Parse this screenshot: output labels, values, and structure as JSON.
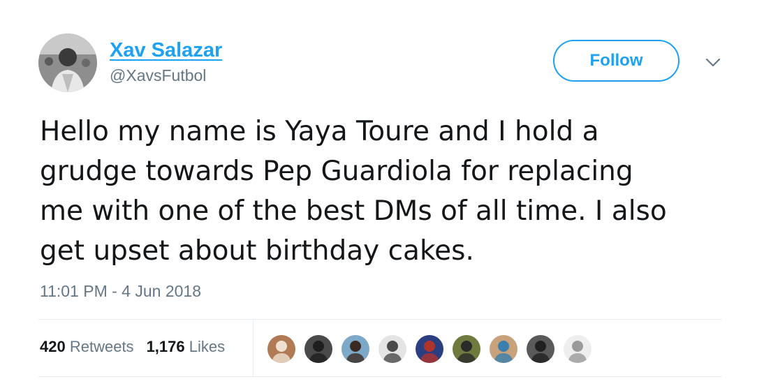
{
  "author": {
    "display_name": "Xav Salazar",
    "handle": "@XavsFutbol",
    "avatar_icon": "user-avatar-icon"
  },
  "actions": {
    "follow_label": "Follow",
    "more_icon": "chevron-down-icon"
  },
  "tweet": {
    "text": "Hello my name is Yaya Toure and I hold a\ngrudge towards Pep Guardiola for replacing\nme with one of the best DMs of all time. I also\nget upset about birthday cakes.",
    "timestamp": "11:01 PM - 4 Jun 2018"
  },
  "stats": {
    "retweets_count": "420",
    "retweets_label": "Retweets",
    "likes_count": "1,176",
    "likes_label": "Likes"
  },
  "likers": [
    {
      "icon": "liker-avatar-icon",
      "bg": "#b07a55",
      "fg": "#efe0d0"
    },
    {
      "icon": "liker-avatar-icon",
      "bg": "#4a4a4a",
      "fg": "#1e1e1e"
    },
    {
      "icon": "liker-avatar-icon",
      "bg": "#7da9c8",
      "fg": "#3b2a22"
    },
    {
      "icon": "liker-avatar-icon",
      "bg": "#e4e4e4",
      "fg": "#4a4a4a"
    },
    {
      "icon": "liker-avatar-icon",
      "bg": "#2b3f80",
      "fg": "#b0342e"
    },
    {
      "icon": "liker-avatar-icon",
      "bg": "#6f7a3f",
      "fg": "#2b2b2b"
    },
    {
      "icon": "liker-avatar-icon",
      "bg": "#c7a27a",
      "fg": "#3b7fb0"
    },
    {
      "icon": "liker-avatar-icon",
      "bg": "#5a5a5a",
      "fg": "#202020"
    },
    {
      "icon": "liker-avatar-icon",
      "bg": "#eeeeee",
      "fg": "#9a9a9a"
    }
  ],
  "colors": {
    "accent": "#1da1f2",
    "text_primary": "#14171a",
    "text_secondary": "#657786",
    "divider": "#e6ecf0"
  }
}
